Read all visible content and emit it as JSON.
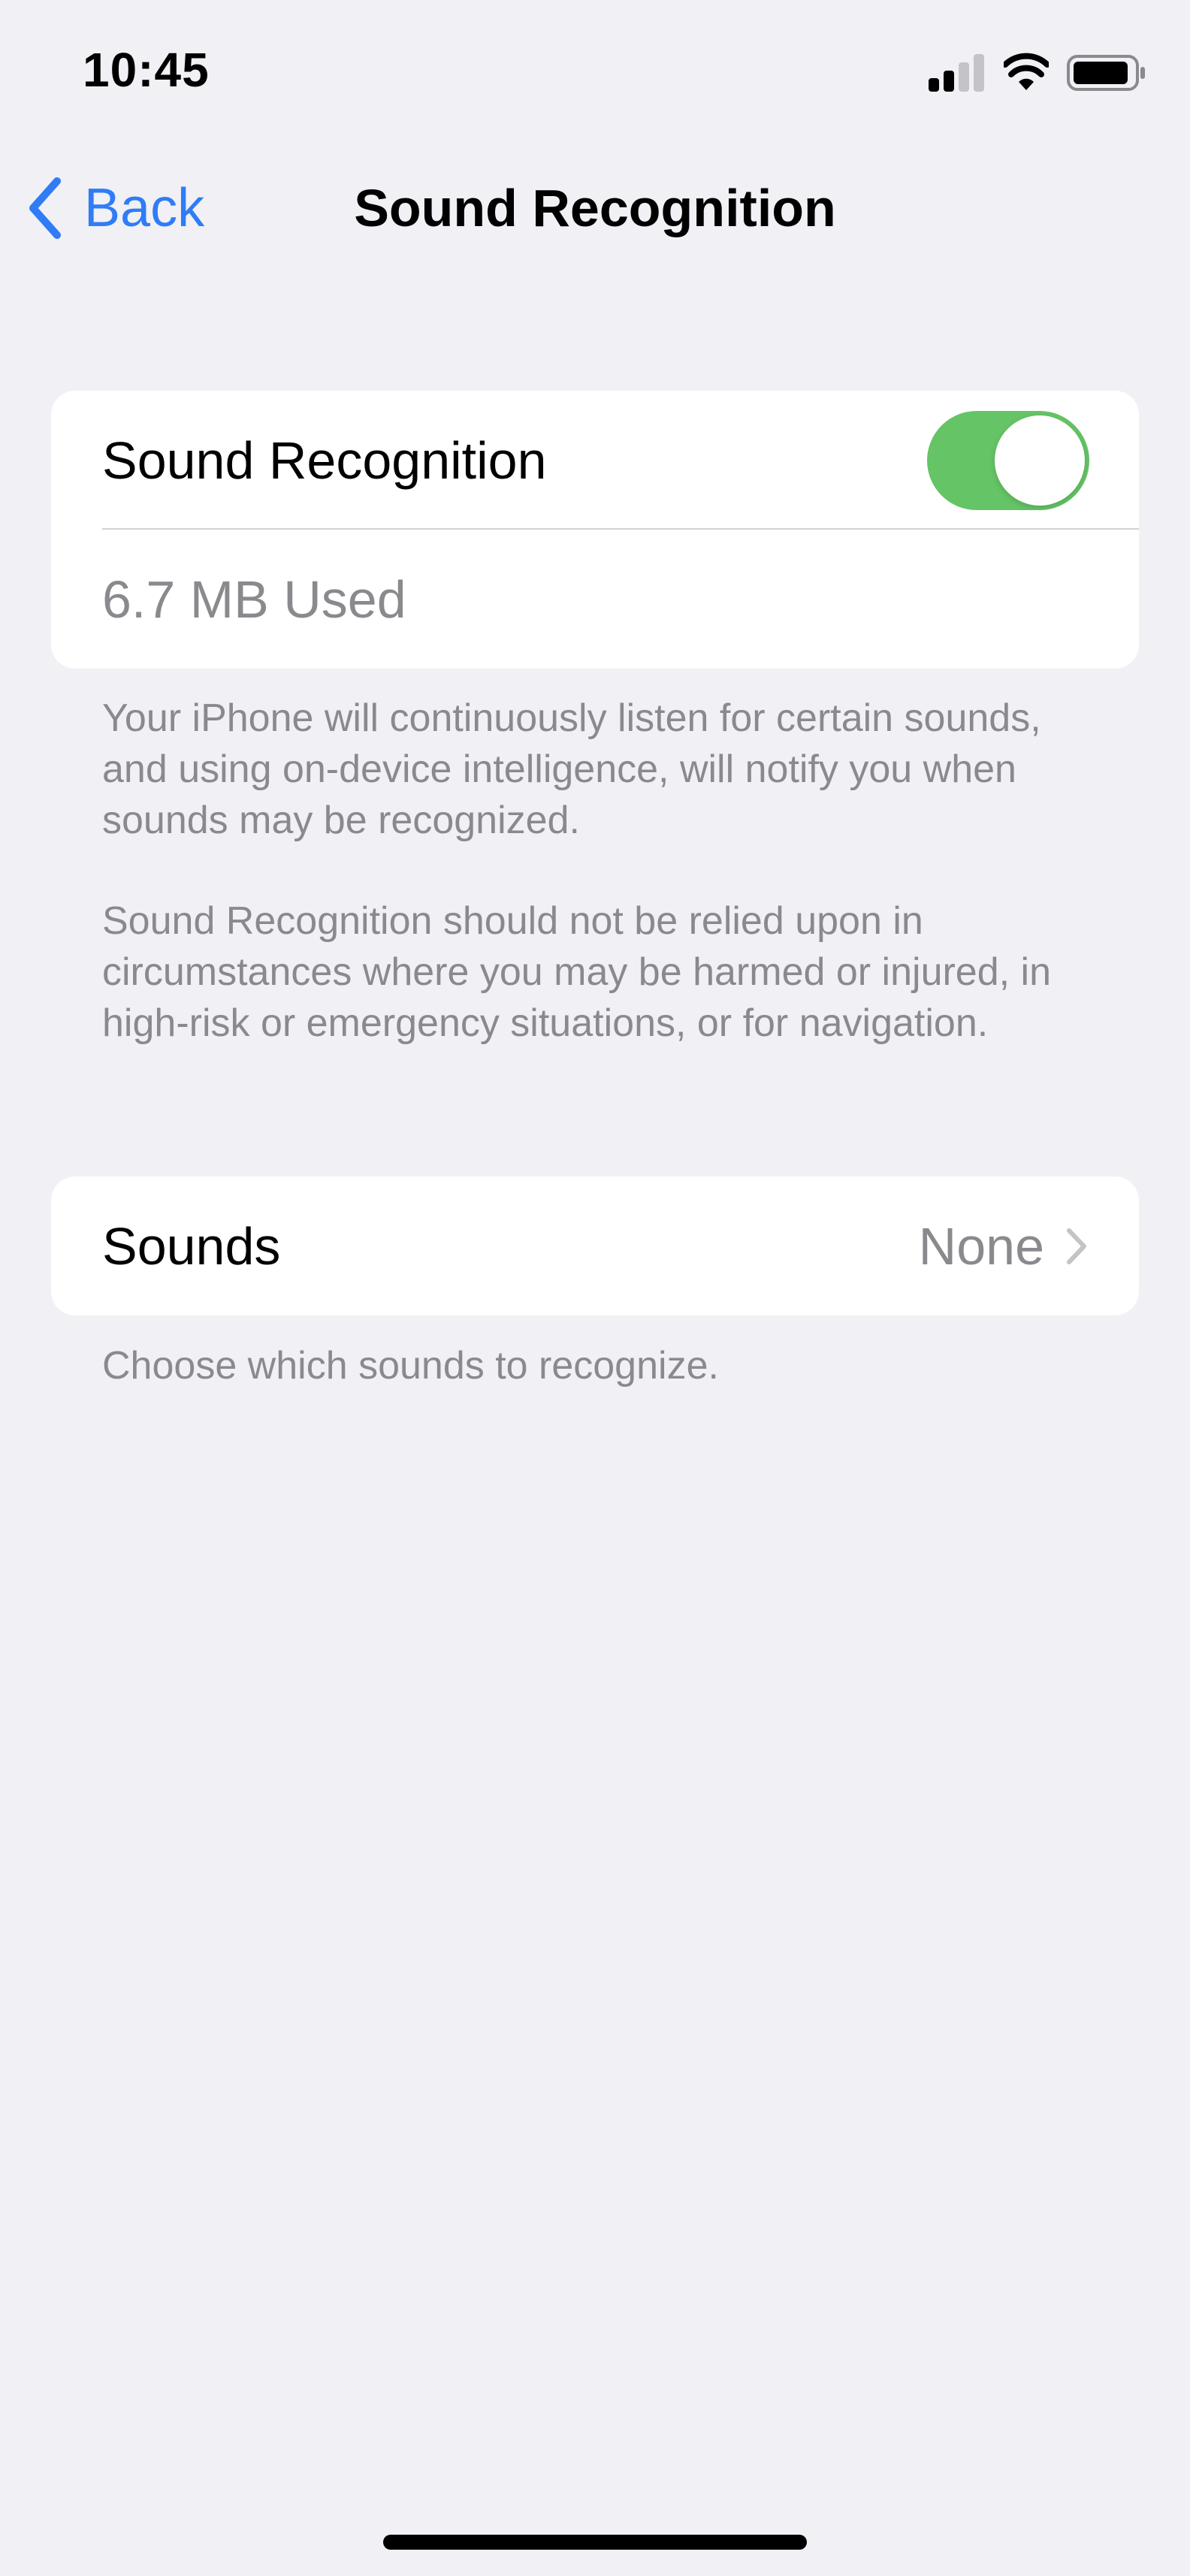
{
  "status_bar": {
    "time": "10:45"
  },
  "nav": {
    "back_label": "Back",
    "title": "Sound Recognition"
  },
  "toggle_group": {
    "label": "Sound Recognition",
    "enabled": true,
    "storage": "6.7 MB Used"
  },
  "footer_1": {
    "paragraph_1": "Your iPhone will continuously listen for certain sounds, and using on-device intelligence, will notify you when sounds may be recognized.",
    "paragraph_2": "Sound Recognition should not be relied upon in circumstances where you may be harmed or injured, in high-risk or emergency situations, or for navigation."
  },
  "sounds_group": {
    "label": "Sounds",
    "value": "None"
  },
  "footer_2": {
    "text": "Choose which sounds to recognize."
  },
  "colors": {
    "accent": "#2f7cf6",
    "toggle_on": "#65c466",
    "background": "#f0f0f5",
    "secondary_text": "#8a8a8e"
  },
  "icons": {
    "back": "chevron-left-icon",
    "disclosure": "chevron-right-icon",
    "signal": "cellular-signal-icon",
    "wifi": "wifi-icon",
    "battery": "battery-icon"
  }
}
